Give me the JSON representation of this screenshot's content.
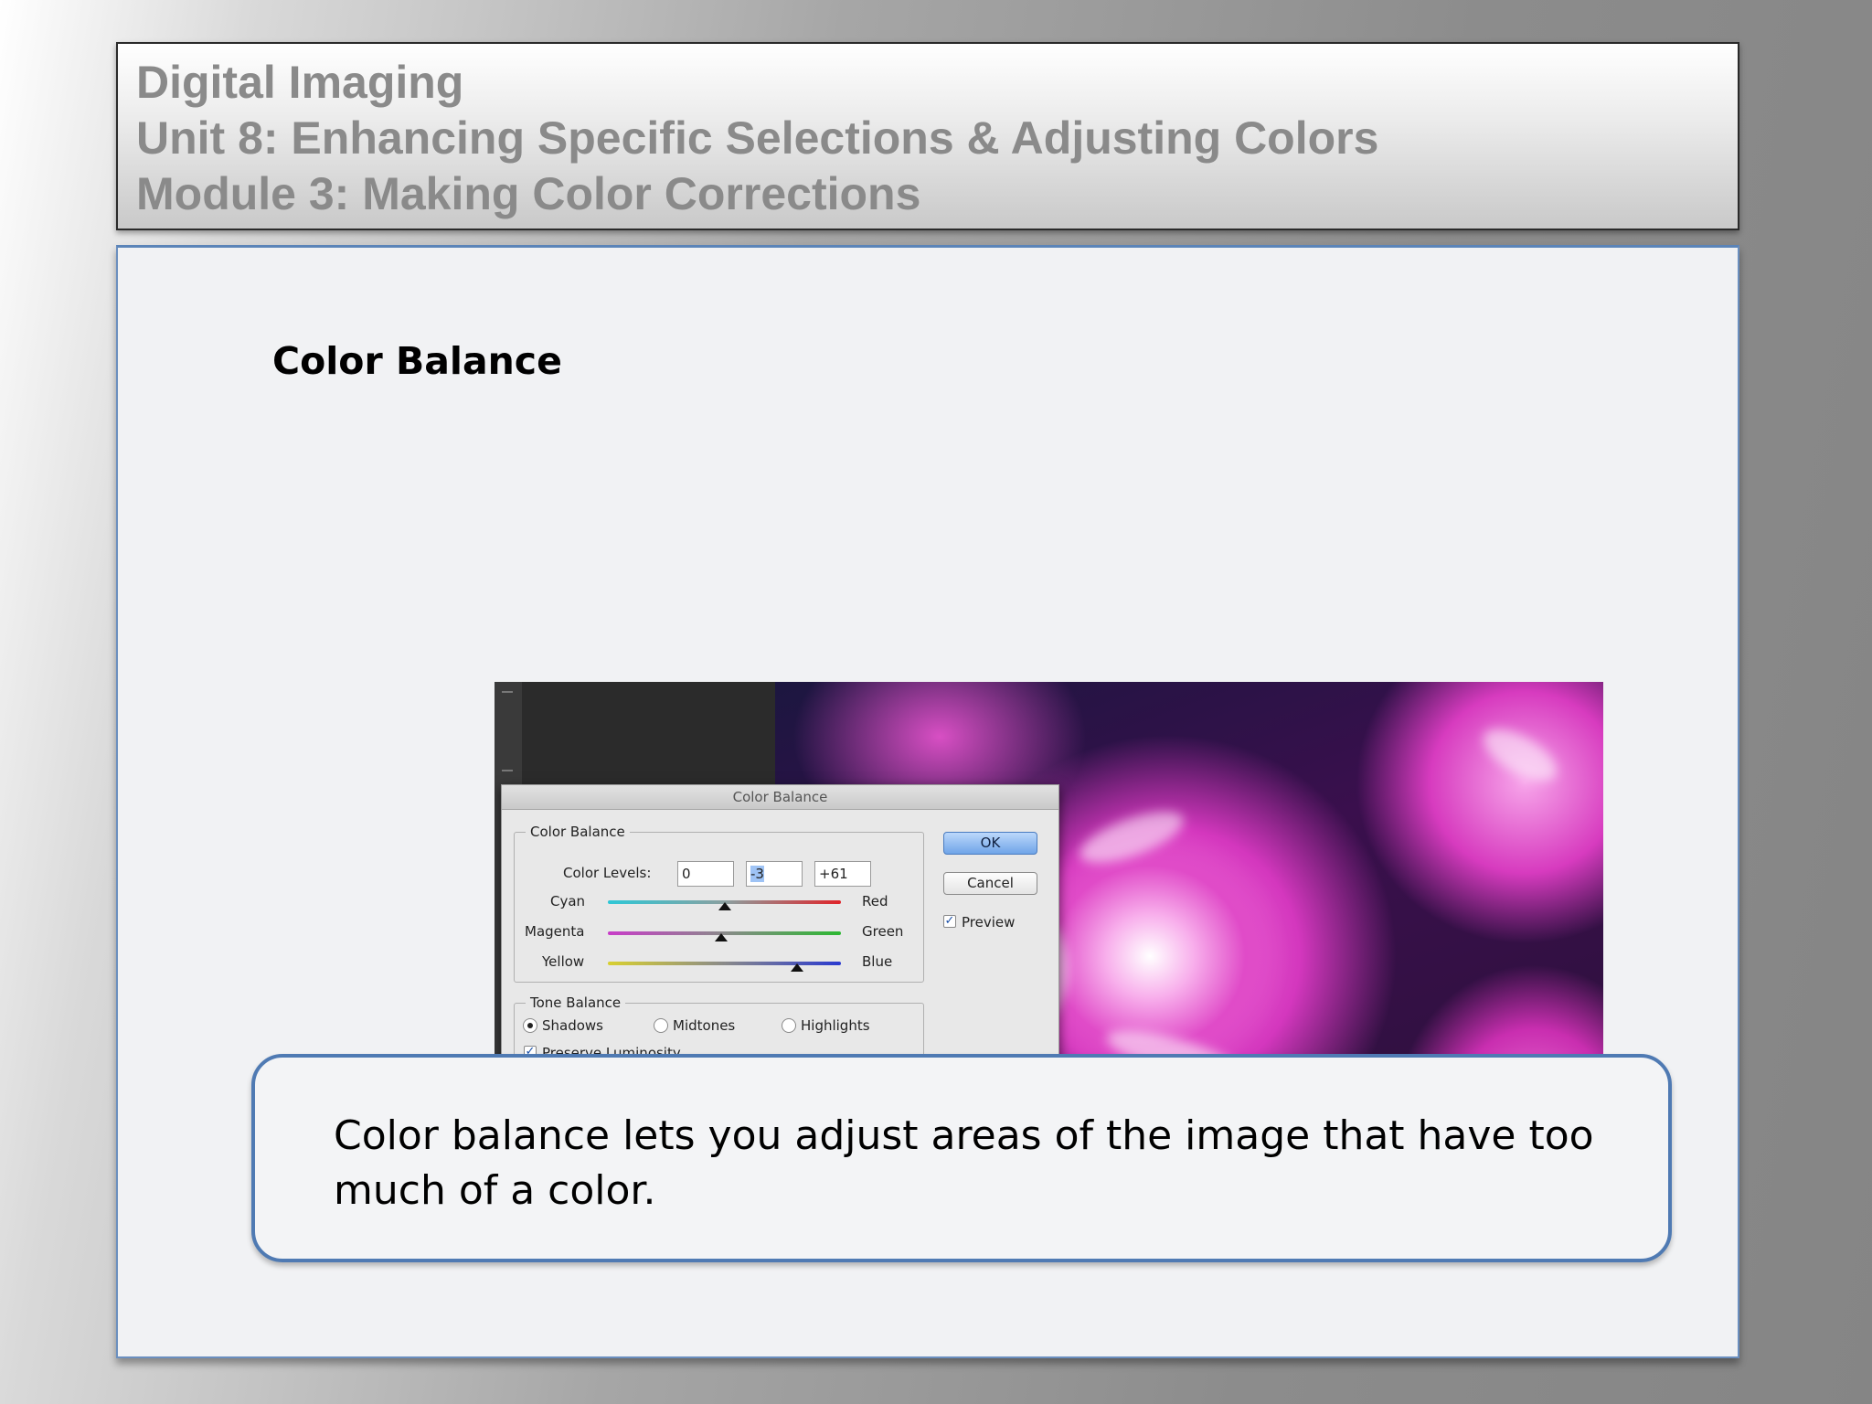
{
  "header": {
    "line1": "Digital Imaging",
    "line2": "Unit 8: Enhancing Specific Selections & Adjusting Colors",
    "line3": "Module 3: Making Color Corrections"
  },
  "slide": {
    "heading": "Color Balance",
    "caption": "Color balance lets you adjust areas of the image that have too much of a color."
  },
  "dialog": {
    "title": "Color Balance",
    "color_balance_group": "Color Balance",
    "color_levels_label": "Color Levels:",
    "levels": [
      "0",
      "-3",
      "+61"
    ],
    "sliders": [
      {
        "left": "Cyan",
        "right": "Red",
        "value": 0,
        "left_color": "#2ec7d6",
        "right_color": "#e0242a"
      },
      {
        "left": "Magenta",
        "right": "Green",
        "value": -3,
        "left_color": "#c83cc8",
        "right_color": "#2cb832"
      },
      {
        "left": "Yellow",
        "right": "Blue",
        "value": 61,
        "left_color": "#d8d030",
        "right_color": "#2a3ad0"
      }
    ],
    "tone_balance_group": "Tone Balance",
    "tones": [
      "Shadows",
      "Midtones",
      "Highlights"
    ],
    "selected_tone": "Shadows",
    "preserve_luminosity": "Preserve Luminosity",
    "ok": "OK",
    "cancel": "Cancel",
    "preview": "Preview"
  }
}
